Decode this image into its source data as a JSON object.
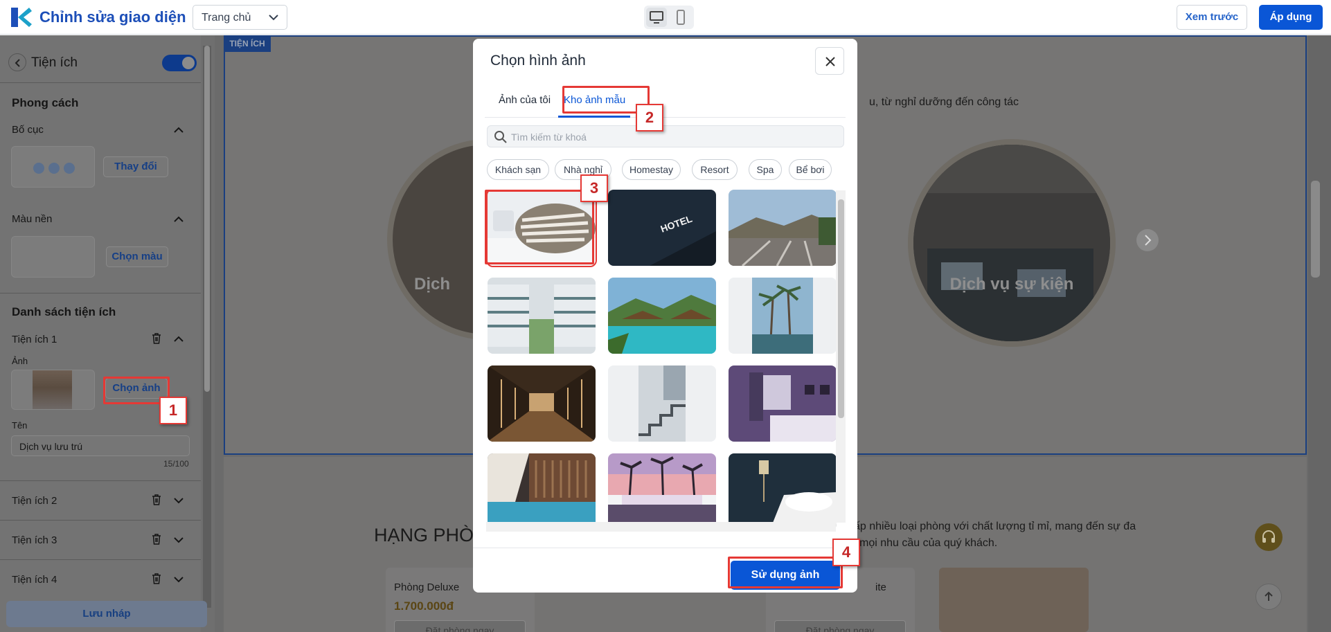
{
  "app": {
    "title": "Chỉnh sửa giao diện",
    "page_select": "Trang chủ",
    "preview_label": "Xem trước",
    "apply_label": "Áp dụng"
  },
  "sidebar": {
    "title": "Tiện ích",
    "style_heading": "Phong cách",
    "layout_label": "Bố cục",
    "layout_change_button": "Thay đổi",
    "bg_color_label": "Màu nền",
    "pick_color_button": "Chọn màu",
    "list_heading": "Danh sách tiện ích",
    "item1": {
      "title": "Tiện ích 1",
      "image_label": "Ảnh",
      "choose_image_button": "Chọn ảnh",
      "name_label": "Tên",
      "name_value": "Dịch vụ lưu trú",
      "char_count": "15/100"
    },
    "item2_title": "Tiện ích 2",
    "item3_title": "Tiện ích 3",
    "item4_title": "Tiện ích 4",
    "save_draft": "Lưu nháp"
  },
  "canvas": {
    "section_tag": "TIỆN ÍCH",
    "subtitle_fragment": "u, từ nghỉ dưỡng đến công tác",
    "circle_left_label": "Dịch",
    "circle_right_label": "Dịch vụ sự kiện",
    "room_heading": "HẠNG PHÒ",
    "room_desc_line1": "ấp nhiều loại phòng với chất lượng tỉ mỉ, mang đến sự đa",
    "room_desc_line2": "i mọi nhu cầu của quý khách.",
    "room_card1": {
      "name": "Phòng Deluxe",
      "price": "1.700.000đ",
      "book": "Đặt phòng ngay"
    },
    "room_card3": {
      "name_fragment": "ite",
      "book": "Đặt phòng ngay"
    }
  },
  "modal": {
    "title": "Chọn hình ảnh",
    "tabs": [
      {
        "label": "Ảnh của tôi",
        "active": false
      },
      {
        "label": "Kho ảnh mẫu",
        "active": true
      }
    ],
    "search_placeholder": "Tìm kiếm từ khoá",
    "chips": [
      "Khách sạn",
      "Nhà nghỉ",
      "Homestay",
      "Resort",
      "Spa",
      "Bể bơi"
    ],
    "images": [
      {
        "icon": "pillow-bed-photo",
        "selected": true
      },
      {
        "icon": "hotel-sign-photo",
        "text": "HOTEL",
        "selected": false
      },
      {
        "icon": "mountain-terrace-photo",
        "selected": false
      },
      {
        "icon": "hotel-courtyard-photo",
        "selected": false
      },
      {
        "icon": "tropical-pool-photo",
        "selected": false
      },
      {
        "icon": "palm-pool-photo",
        "selected": false
      },
      {
        "icon": "corridor-photo",
        "selected": false
      },
      {
        "icon": "staircase-photo",
        "selected": false
      },
      {
        "icon": "purple-bedroom-photo",
        "selected": false
      },
      {
        "icon": "indoor-pool-photo",
        "selected": false
      },
      {
        "icon": "sunset-pool-photo",
        "selected": false
      },
      {
        "icon": "dark-bedroom-photo",
        "selected": false
      }
    ],
    "use_button": "Sử dụng ảnh"
  },
  "annotations": [
    "1",
    "2",
    "3",
    "4"
  ],
  "colors": {
    "primary": "#0a56d6",
    "annotation_red": "#e53935",
    "title_blue": "#1d4fb8"
  }
}
